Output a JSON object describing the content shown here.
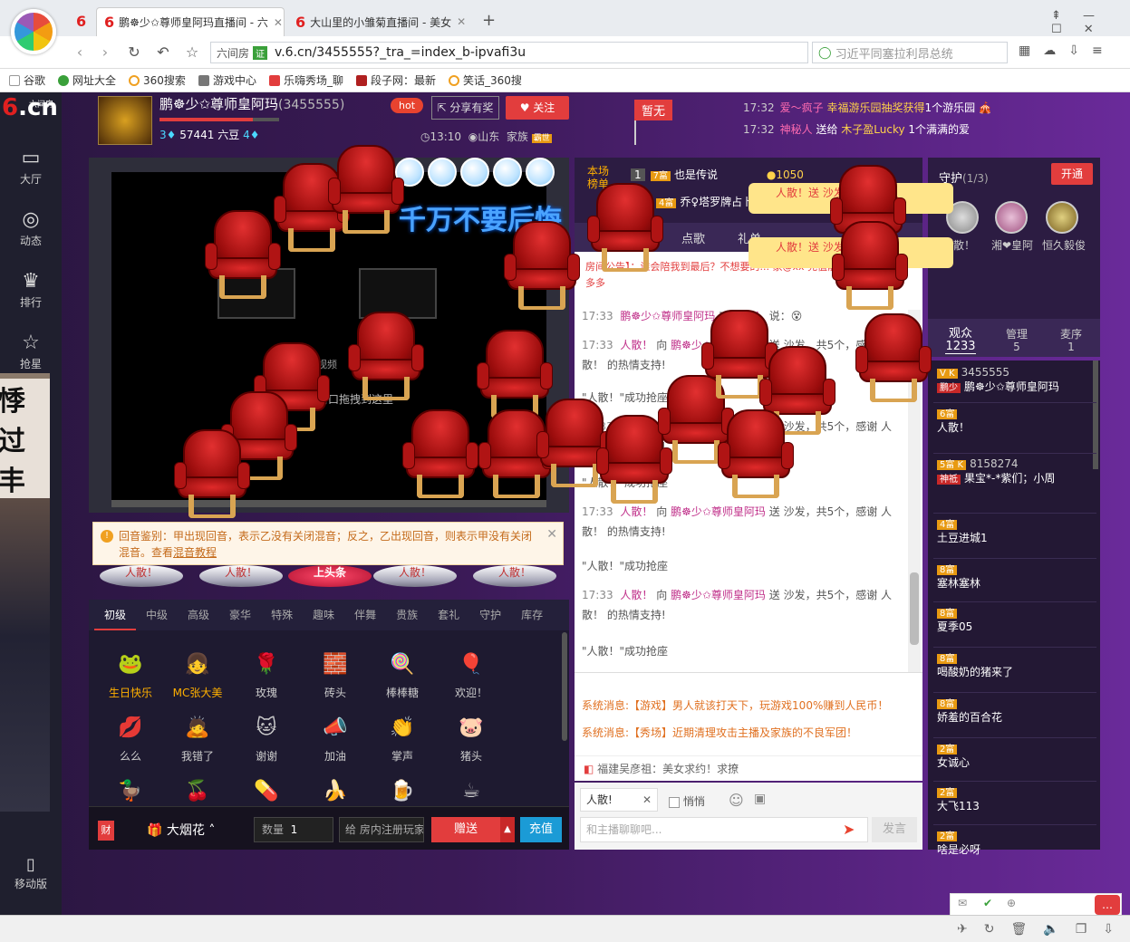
{
  "browser": {
    "tabs": [
      {
        "label": "鹏☸少✩尊师皇阿玛直播间 - 六",
        "active": true
      },
      {
        "label": "大山里的小雏菊直播间 - 美女",
        "active": false
      }
    ],
    "new_tab": "+",
    "url_site": "六间房",
    "url_cert": "证",
    "url": "v.6.cn/3455555?_tra_=index_b-ipvafi3u",
    "search_text": "习近平同塞拉利昂总统",
    "bookmarks": [
      "谷歌",
      "网址大全",
      "360搜索",
      "游戏中心",
      "乐嗨秀场_聊",
      "段子网：最新",
      "笑话_360搜"
    ]
  },
  "site": {
    "logo_six": "6",
    "logo_cn": ".cn",
    "logo_small": "六间房",
    "nav": [
      {
        "icon": "tv-icon",
        "glyph": "▭",
        "label": "大厅"
      },
      {
        "icon": "compass-icon",
        "glyph": "◎",
        "label": "动态"
      },
      {
        "icon": "crown-icon",
        "glyph": "♛",
        "label": "排行"
      },
      {
        "icon": "star-icon",
        "glyph": "☆",
        "label": "抢星"
      }
    ],
    "mobile_label": "移动版",
    "left_overlay_text": "悸过丰"
  },
  "anchor": {
    "name": "鹏☸少✩尊师皇阿玛",
    "id": "(3455555)",
    "level_left": "3",
    "beans": "57441 六豆",
    "level_right": "4",
    "level_progress": 0.78,
    "hot": "hot",
    "share": "分享有奖",
    "follow": "关注",
    "time": "13:10",
    "location": "山东",
    "family": "家族",
    "family_badge": "霸世"
  },
  "flag": "暂无",
  "notices": [
    {
      "time": "17:32",
      "user": "爱～疯子",
      "text": "幸福游乐园抽奖获得",
      "item": "1个游乐园"
    },
    {
      "time": "17:32",
      "user": "神秘人",
      "text": "送给",
      "target": "木子盈Lucky",
      "item": "1个满满的爱"
    }
  ],
  "video": {
    "banner": "千万不要后悔",
    "drag_tip": "窗口拖拽到这里",
    "video_label": "视频"
  },
  "echo": {
    "text": "回音鉴别：甲出现回音，表示乙没有关闭混音；反之，乙出现回音，则表示甲没有关闭混音。查看",
    "link": "混音教程"
  },
  "seats": [
    "人散！",
    "人散！",
    "上头条",
    "人散！",
    "人散！"
  ],
  "gift_tabs": [
    "初级",
    "中级",
    "高级",
    "豪华",
    "特殊",
    "趣味",
    "伴舞",
    "贵族",
    "套礼",
    "守护",
    "库存"
  ],
  "gifts": [
    {
      "name": "生日快乐",
      "icon": "frog-icon",
      "glyph": "🐸",
      "highlight": true
    },
    {
      "name": "MC张大美",
      "icon": "girl-icon",
      "glyph": "👧",
      "highlight": true
    },
    {
      "name": "玫瑰",
      "icon": "rose-icon",
      "glyph": "🌹",
      "highlight": false
    },
    {
      "name": "砖头",
      "icon": "brick-icon",
      "glyph": "🧱",
      "highlight": false
    },
    {
      "name": "棒棒糖",
      "icon": "lollipop-icon",
      "glyph": "🍭",
      "highlight": false
    },
    {
      "name": "欢迎！",
      "icon": "balloon-icon",
      "glyph": "🎈",
      "highlight": false
    },
    {
      "name": "么么",
      "icon": "lips-icon",
      "glyph": "💋",
      "highlight": false
    },
    {
      "name": "我错了",
      "icon": "sorry-icon",
      "glyph": "🙇",
      "highlight": false
    },
    {
      "name": "谢谢",
      "icon": "cat-icon",
      "glyph": "🐱",
      "highlight": false
    },
    {
      "name": "加油",
      "icon": "cheer-icon",
      "glyph": "📣",
      "highlight": false
    },
    {
      "name": "掌声",
      "icon": "clap-icon",
      "glyph": "👏",
      "highlight": false
    },
    {
      "name": "猪头",
      "icon": "pig-icon",
      "glyph": "🐷",
      "highlight": false
    }
  ],
  "sendbar": {
    "cai": "财",
    "gift_selected": "大烟花",
    "qty_label": "数量",
    "qty": "1",
    "to_label": "给",
    "to_placeholder": "房内注册玩家",
    "send": "赠送",
    "recharge": "充值"
  },
  "rank": {
    "label": "本场榜单",
    "rows": [
      {
        "no": "1",
        "badge": "7富",
        "name": "也是传说",
        "value": "1050"
      },
      {
        "no": "",
        "badge": "4富",
        "name": "乔♀塔罗牌占卜",
        "value": ""
      }
    ],
    "popups": [
      {
        "text": "人散！送 沙发",
        "count": "5个"
      },
      {
        "text": "人散！送 沙发",
        "count": "5个"
      }
    ]
  },
  "chat_tabs": [
    "",
    "点歌",
    "礼单",
    ""
  ],
  "chat": {
    "announcement": "房间公告】：谁会陪我到最后？不想要的... 家@xx 充值靓号绿卡点击优惠多多",
    "messages": [
      {
        "time": "17:33",
        "from": "鹏☸少✩尊师皇阿玛",
        "text": "对",
        "to": "人散！",
        "tail": "说：😵"
      },
      {
        "time": "17:33",
        "from": "人散！",
        "text": "向",
        "to": "鹏☸少✩尊师皇阿玛",
        "tail": "送 沙发，共5个，感谢 人散！ 的热情支持!"
      },
      {
        "time": "",
        "from": "",
        "text": "\"人散！\"成功抢座",
        "to": "",
        "tail": ""
      },
      {
        "time": "17:33",
        "from": "人散！",
        "text": "向",
        "to": "鹏☸少✩尊师皇阿玛",
        "tail": "送 沙发，共5个，感谢 人散！ 的热情支持!"
      },
      {
        "time": "",
        "from": "",
        "text": "\"人散！\"成功抢座",
        "to": "",
        "tail": ""
      },
      {
        "time": "17:33",
        "from": "人散！",
        "text": "向",
        "to": "鹏☸少✩尊师皇阿玛",
        "tail": "送 沙发，共5个，感谢 人散！ 的热情支持!"
      },
      {
        "time": "",
        "from": "",
        "text": "\"人散！\"成功抢座",
        "to": "",
        "tail": ""
      },
      {
        "time": "17:33",
        "from": "人散！",
        "text": "向",
        "to": "鹏☸少✩尊师皇阿玛",
        "tail": "送 沙发，共5个，感谢 人散！ 的热情支持!"
      },
      {
        "time": "",
        "from": "",
        "text": "\"人散！\"成功抢座",
        "to": "",
        "tail": ""
      }
    ],
    "system": [
      "系统消息:【游戏】男人就该打天下，玩游戏100%赚到人民币！",
      "系统消息:【秀场】近期清理攻击主播及家族的不良军团！"
    ],
    "fujian": "福建吴彦祖：美女求约！求撩",
    "target": "人散!",
    "whisper": "悄悄",
    "placeholder": "和主播聊聊吧...",
    "send": "发言"
  },
  "guard": {
    "title": "守护",
    "count": "(1/3)",
    "open": "开通",
    "members": [
      "人散！",
      "湘❤皇阿",
      "恒久毅俊"
    ]
  },
  "audience": {
    "tabs": [
      {
        "label": "观众",
        "count": "1233"
      },
      {
        "label": "管理",
        "count": "5"
      },
      {
        "label": "麦序",
        "count": "1"
      }
    ],
    "list": [
      {
        "badge": "V K",
        "id": "3455555",
        "name": "鹏☸少✩尊师皇阿玛",
        "tag": "鹏少"
      },
      {
        "badge": "6富",
        "id": "",
        "name": "人散！",
        "tag": ""
      },
      {
        "badge": "5富 K",
        "id": "8158274",
        "name": "果宝*-*紫们；小周",
        "tag": "神祗"
      },
      {
        "badge": "4富",
        "id": "",
        "name": "土豆进城1",
        "tag": ""
      },
      {
        "badge": "8富",
        "id": "",
        "name": "塞林塞林",
        "tag": ""
      },
      {
        "badge": "8富",
        "id": "",
        "name": "夏季05",
        "tag": ""
      },
      {
        "badge": "8富",
        "id": "",
        "name": "喝酸奶的猪来了",
        "tag": ""
      },
      {
        "badge": "8富",
        "id": "",
        "name": "娇羞的百合花",
        "tag": ""
      },
      {
        "badge": "2富",
        "id": "",
        "name": "女诚心",
        "tag": ""
      },
      {
        "badge": "2富",
        "id": "",
        "name": "大飞113",
        "tag": ""
      },
      {
        "badge": "2富",
        "id": "",
        "name": "啥是必呀",
        "tag": ""
      }
    ]
  }
}
